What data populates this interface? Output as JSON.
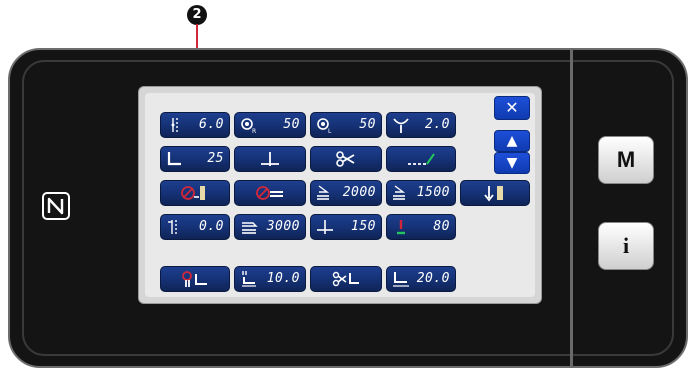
{
  "callout": {
    "number": "2"
  },
  "grid": {
    "row1": [
      {
        "icon": "thread-tension-icon",
        "value": "6.0"
      },
      {
        "icon": "presser-right-icon",
        "value": "50"
      },
      {
        "icon": "presser-left-icon",
        "value": "50"
      },
      {
        "icon": "stitch-length-icon",
        "value": "2.0"
      }
    ],
    "row2": [
      {
        "icon": "presser-foot-pressure-icon",
        "value": "25"
      },
      {
        "icon": "needle-position-icon",
        "value": ""
      },
      {
        "icon": "thread-trimmer-icon",
        "value": ""
      },
      {
        "icon": "stitch-line-icon",
        "value": ""
      }
    ],
    "row3": [
      {
        "icon": "foot-lift-disabled-icon",
        "value": ""
      },
      {
        "icon": "wiper-disabled-icon",
        "value": ""
      },
      {
        "icon": "max-speed-icon",
        "value": "2000"
      },
      {
        "icon": "soft-start-speed-icon",
        "value": "1500"
      },
      {
        "icon": "reverse-feed-icon",
        "value": ""
      }
    ],
    "row4": [
      {
        "icon": "feed-offset-icon",
        "value": "0.0"
      },
      {
        "icon": "speed-sewing-icon",
        "value": "3000"
      },
      {
        "icon": "needle-height-icon",
        "value": "150"
      },
      {
        "icon": "alarm-icon",
        "value": "80"
      }
    ],
    "row5": [
      {
        "icon": "pause-foot-icon",
        "value": ""
      },
      {
        "icon": "foot-height-icon",
        "value": "10.0"
      },
      {
        "icon": "trim-foot-icon",
        "value": ""
      },
      {
        "icon": "foot-stroke-icon",
        "value": "20.0"
      }
    ]
  },
  "nav": {
    "close": "✕",
    "up": "▲",
    "down": "▼"
  },
  "side": {
    "mode_label": "M",
    "info_label": "i"
  },
  "colors": {
    "button": "#153174",
    "accent_red": "#d0283a",
    "accent_green": "#22c55e"
  }
}
